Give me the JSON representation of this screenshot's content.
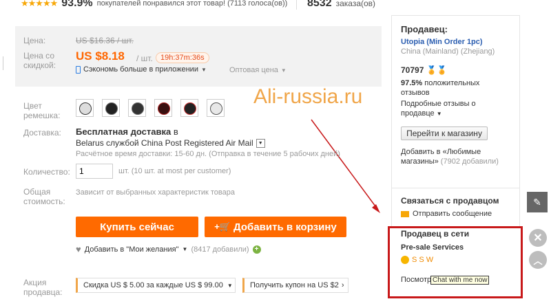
{
  "top": {
    "stars": "★★★★★",
    "percent": "93.9%",
    "liked_text": "покупателей понравился этот товар! (7113 голоса(ов))",
    "orders_count": "8532",
    "orders_label": "заказа(ов)"
  },
  "price": {
    "label_price": "Цена:",
    "old_price": "US $16.36 / шт.",
    "label_discount": "Цена со скидкой:",
    "new_price": "US $8.18",
    "unit": "/ шт.",
    "timer": "19h:37m:36s",
    "app_saving": "Сэкономь больше в приложении",
    "wholesale": "Оптовая цена"
  },
  "watermark": "Ali-russia.ru",
  "options": {
    "color_label": "Цвет ремешка:",
    "shipping_label": "Доставка:",
    "shipping_free": "Бесплатная доставка",
    "shipping_to": "в",
    "shipping_country": "Belarus службой China Post Registered Air Mail",
    "shipping_time": "Расчётное время доставки: 15-60 дн. (Отправка в течение 5 рабочих дней)",
    "qty_label": "Количество:",
    "qty_value": "1",
    "qty_note": "шт. (10 шт. at most per customer)",
    "total_label": "Общая стоимость:",
    "total_value": "Зависит от выбранных характеристик товара"
  },
  "actions": {
    "buy_now": "Купить сейчас",
    "add_to_cart": "Добавить в корзину",
    "wishlist": "Добавить в \"Мои желания\"",
    "wishlist_count": "(8417 добавили)"
  },
  "promo": {
    "label": "Акция продавца:",
    "discount": "Скидка US $ 5.00 за каждые US $ 99.00",
    "coupon": "Получить купон на US $2"
  },
  "seller": {
    "title": "Продавец:",
    "store_name": "Utopia (Min Order 1pc)",
    "location": "China (Mainland) (Zhejiang)",
    "score": "70797",
    "positive_pct": "97.5%",
    "positive_text": "положительных отзывов",
    "details_link": "Подробные отзывы о продавце",
    "go_to_store": "Перейти к магазину",
    "add_fav": "Добавить в «Любимые магазины»",
    "fav_count": "(7902 добавили)"
  },
  "contact": {
    "title": "Связаться с продавцом",
    "send_message": "Отправить сообщение"
  },
  "online": {
    "title": "Продавец в сети",
    "presale": "Pre-sale Services",
    "agent": "S S W",
    "view": "Посмотр",
    "tooltip": "Chat with me now"
  },
  "colors": {
    "accent": "#ff6a00",
    "price": "#ff6600",
    "highlight_box": "#c8191a",
    "arrow": "#c8191a"
  }
}
